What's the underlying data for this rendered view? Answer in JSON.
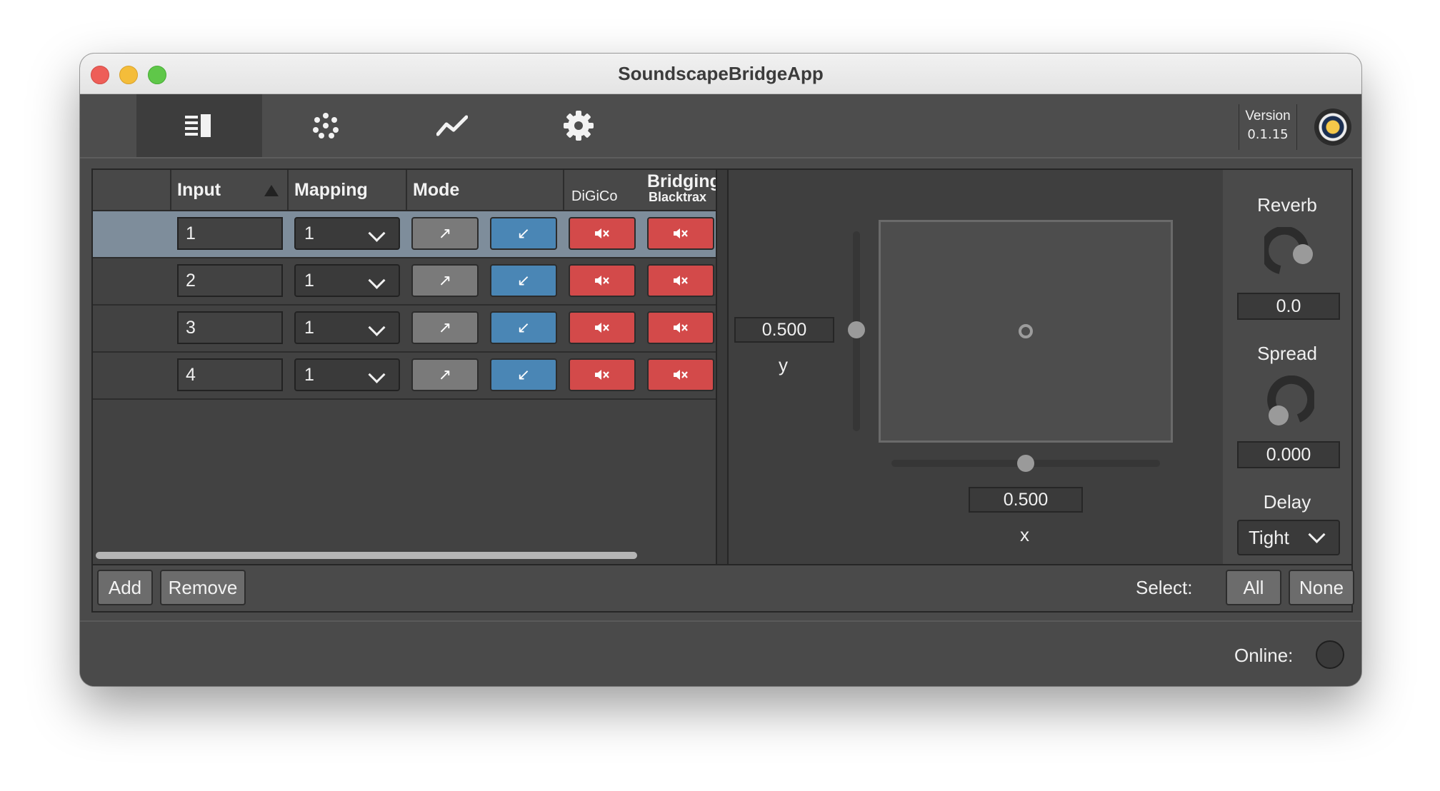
{
  "window": {
    "title": "SoundscapeBridgeApp"
  },
  "toolbar": {
    "tabs": [
      {
        "icon": "table-view-icon"
      },
      {
        "icon": "multi-slider-dots-icon"
      },
      {
        "icon": "chart-line-icon"
      },
      {
        "icon": "gear-icon"
      }
    ],
    "version_label": "Version",
    "version_number": "0.1.15"
  },
  "table": {
    "headers": {
      "input": "Input",
      "mapping": "Mapping",
      "mode": "Mode",
      "bridging": "Bridging",
      "digico": "DiGiCo",
      "blacktrax": "Blacktrax"
    },
    "rows": [
      {
        "input": "1",
        "mapping": "1",
        "mode_tx": "↗",
        "mode_rx": "↙",
        "selected": true
      },
      {
        "input": "2",
        "mapping": "1",
        "mode_tx": "↗",
        "mode_rx": "↙",
        "selected": false
      },
      {
        "input": "3",
        "mapping": "1",
        "mode_tx": "↗",
        "mode_rx": "↙",
        "selected": false
      },
      {
        "input": "4",
        "mapping": "1",
        "mode_tx": "↗",
        "mode_rx": "↙",
        "selected": false
      }
    ],
    "mute_icon": "speaker-muted-icon"
  },
  "position": {
    "y_value": "0.500",
    "y_label": "y",
    "x_value": "0.500",
    "x_label": "x",
    "y_slider": 0.5,
    "x_slider": 0.5
  },
  "sidebar": {
    "reverb_label": "Reverb",
    "reverb_value": "0.0",
    "spread_label": "Spread",
    "spread_value": "0.000",
    "delay_label": "Delay",
    "delay_value": "Tight"
  },
  "bottom": {
    "add_label": "Add",
    "remove_label": "Remove",
    "select_label": "Select:",
    "all_label": "All",
    "none_label": "None"
  },
  "status": {
    "online_label": "Online:"
  },
  "colors": {
    "accent_blue": "#4a86b5",
    "mute_red": "#d34a4a",
    "selected_row": "#7e8d9b",
    "logo_yellow": "#f5c84a"
  }
}
